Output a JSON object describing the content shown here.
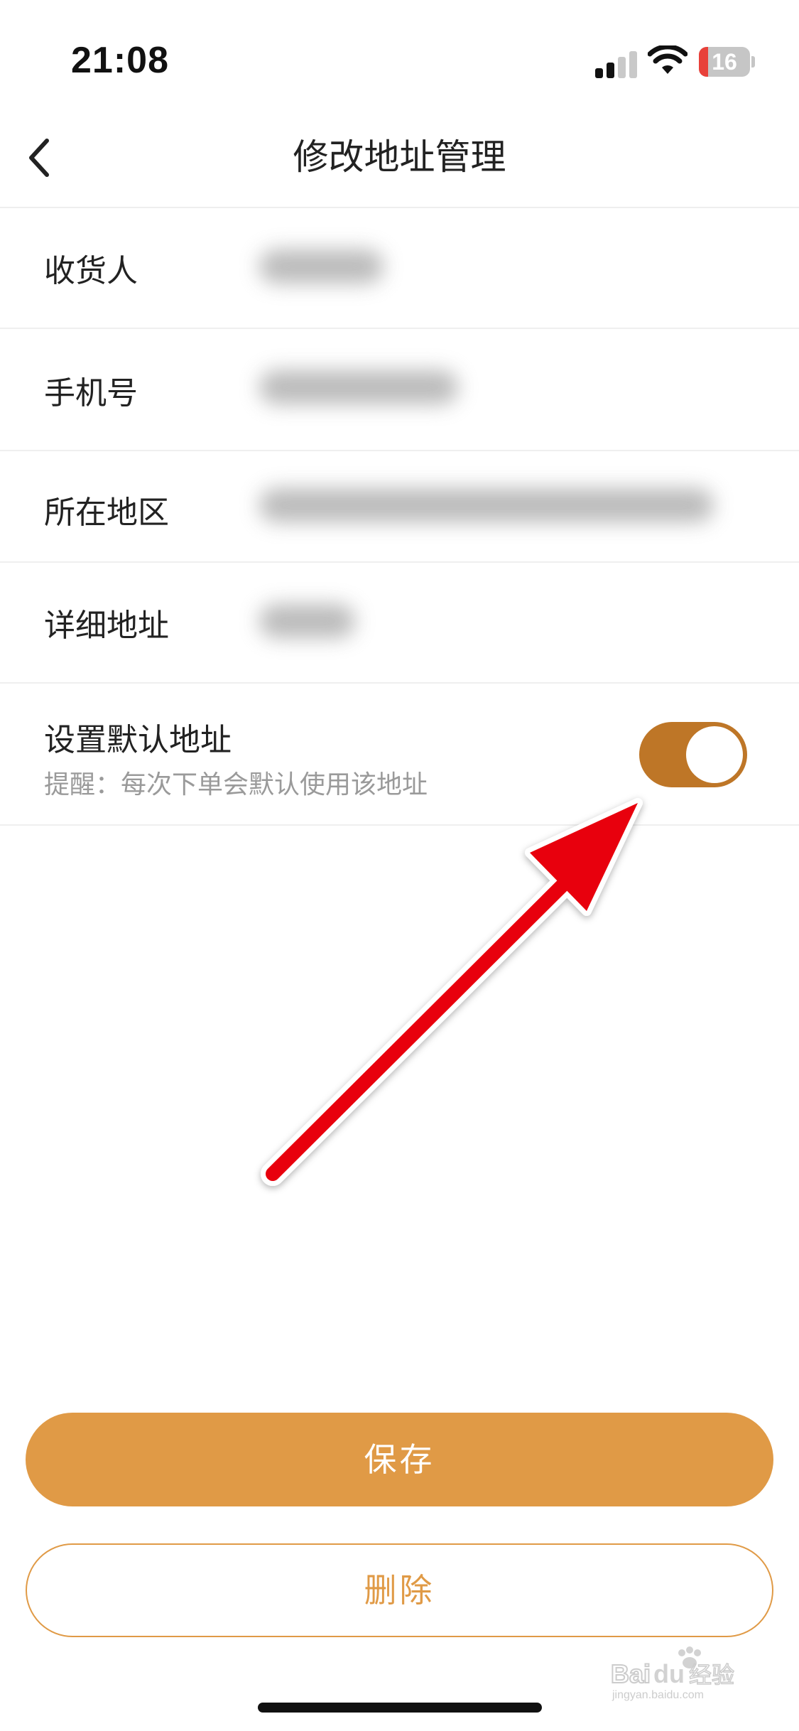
{
  "status_bar": {
    "time": "21:08",
    "battery_level": "16",
    "icons": [
      "cellular-signal-icon",
      "wifi-icon",
      "battery-icon"
    ]
  },
  "nav": {
    "title": "修改地址管理",
    "back_icon": "chevron-left-icon"
  },
  "form": {
    "rows": [
      {
        "label": "收货人",
        "value": ""
      },
      {
        "label": "手机号",
        "value": ""
      },
      {
        "label": "所在地区",
        "value": ""
      },
      {
        "label": "详细地址",
        "value": ""
      }
    ],
    "default_address": {
      "label": "设置默认地址",
      "hint": "提醒：每次下单会默认使用该地址",
      "enabled": true
    }
  },
  "buttons": {
    "save_label": "保存",
    "delete_label": "删除"
  },
  "watermark": {
    "text": "Baidu 经验",
    "sub": "jingyan.baidu.com"
  },
  "colors": {
    "accent": "#e09a46",
    "toggle_on": "#be7627",
    "annotation": "#e8000b"
  }
}
